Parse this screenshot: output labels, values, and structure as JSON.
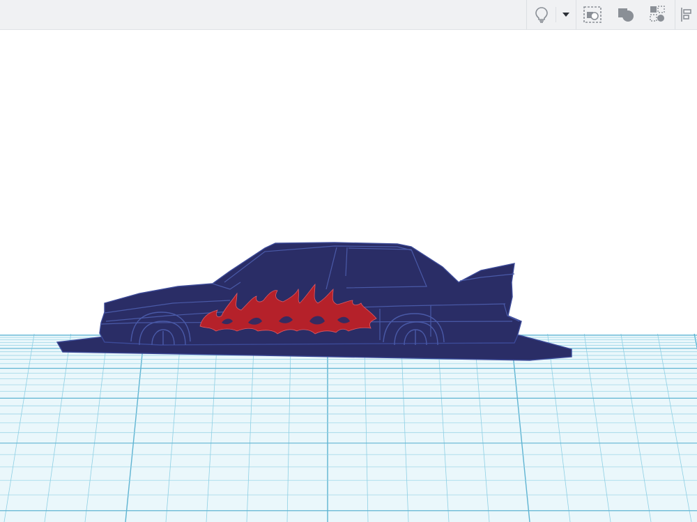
{
  "toolbar": {
    "tools": [
      {
        "name": "show-notes",
        "icon": "lightbulb-icon"
      },
      {
        "name": "notes-menu",
        "icon": "caret-down-icon"
      },
      {
        "name": "group-view",
        "icon": "workplane-icon"
      },
      {
        "name": "hole",
        "icon": "solid-hole-icon"
      },
      {
        "name": "ungroup",
        "icon": "shapes-icon"
      },
      {
        "name": "align",
        "icon": "align-icon"
      }
    ]
  },
  "scene": {
    "model": "car-silhouette",
    "body_color": "#2a2d66",
    "edge_color": "#4a5aa8",
    "flame_color": "#b5212a",
    "grid_color": "#8fd0e4",
    "grid_major_color": "#5fb4d2",
    "grid_background": "#eaf7fb"
  }
}
